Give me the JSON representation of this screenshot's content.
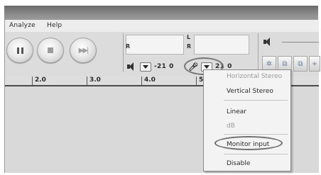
{
  "menubar": {
    "items": [
      "Analyze",
      "Help"
    ]
  },
  "toolbar": {
    "meter_left_channel_r": "R",
    "meter_right_channel_l": "L",
    "meter_right_channel_r": "R",
    "playback_db": "-21",
    "playback_zero": "0",
    "recording_db": "21",
    "recording_zero": "0",
    "icons": [
      "pause-icon",
      "stop-icon",
      "skip-end-icon",
      "speaker-icon",
      "microphone-icon",
      "volume-icon"
    ]
  },
  "ruler": {
    "ticks": [
      "2.0",
      "3.0",
      "4.0",
      "5"
    ]
  },
  "popup_menu": {
    "items": [
      {
        "label": "Horizontal Stereo",
        "enabled": false
      },
      {
        "label": "Vertical Stereo",
        "enabled": true
      },
      {
        "label": "Linear",
        "enabled": true
      },
      {
        "label": "dB",
        "enabled": false
      },
      {
        "label": "Monitor input",
        "enabled": true,
        "highlighted": true
      },
      {
        "label": "Disable",
        "enabled": true
      }
    ]
  }
}
